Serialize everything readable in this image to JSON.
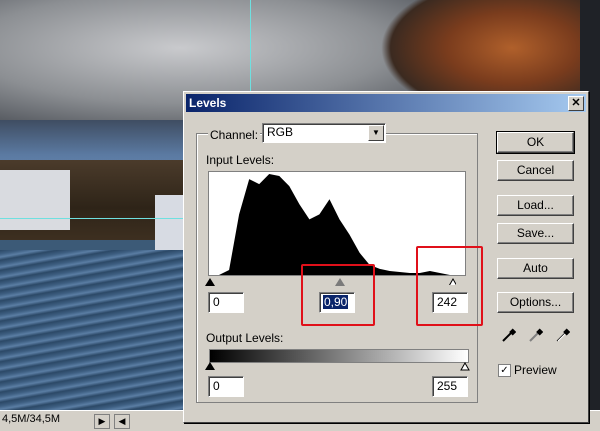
{
  "status_bar": {
    "doc_size": "4,5M/34,5M",
    "arrow_right": "▶",
    "arrow_left": "◀"
  },
  "dialog": {
    "title": "Levels",
    "close_label": "✕",
    "channel": {
      "label": "Channel:",
      "value": "RGB"
    },
    "input_levels": {
      "label": "Input Levels:",
      "black": "0",
      "gamma": "0,90",
      "white": "242"
    },
    "output_levels": {
      "label": "Output Levels:",
      "black": "0",
      "white": "255"
    },
    "buttons": {
      "ok": "OK",
      "cancel": "Cancel",
      "load": "Load...",
      "save": "Save...",
      "auto": "Auto",
      "options": "Options..."
    },
    "preview": {
      "label": "Preview",
      "checked": true
    }
  },
  "icons": {
    "black_eyedropper": "eyedropper-black-icon",
    "gray_eyedropper": "eyedropper-gray-icon",
    "white_eyedropper": "eyedropper-white-icon"
  },
  "chart_data": {
    "type": "area",
    "x": [
      0,
      10,
      20,
      30,
      40,
      50,
      60,
      70,
      80,
      90,
      100,
      110,
      120,
      130,
      140,
      150,
      160,
      170,
      180,
      190,
      200,
      210,
      220,
      230,
      240,
      255
    ],
    "values": [
      0,
      0,
      5,
      60,
      95,
      90,
      100,
      98,
      88,
      70,
      55,
      60,
      75,
      55,
      40,
      22,
      10,
      6,
      4,
      3,
      2,
      2,
      4,
      2,
      0,
      0
    ],
    "xlim": [
      0,
      255
    ],
    "ylim": [
      0,
      100
    ]
  },
  "colors": {
    "titlebar": "#0a246a",
    "highlight": "#e0101a",
    "dialog_bg": "#d4d0c8"
  }
}
